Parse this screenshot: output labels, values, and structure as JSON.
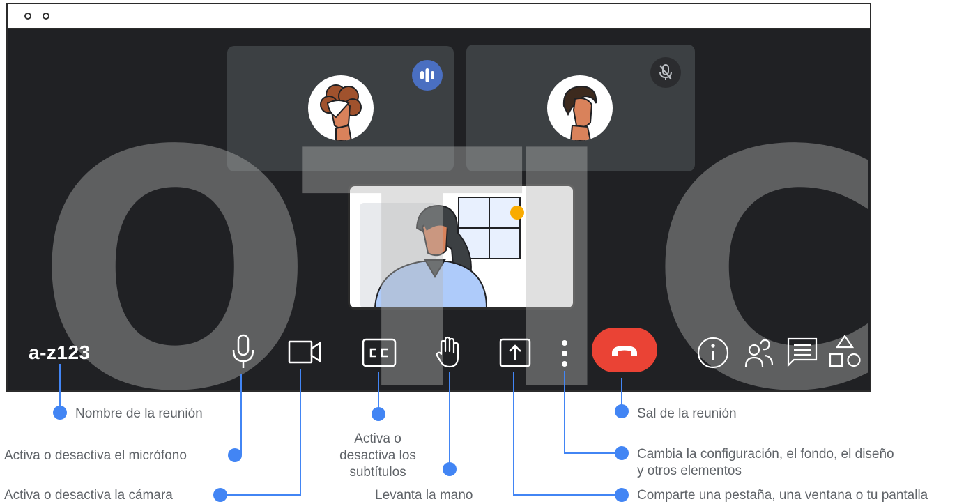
{
  "meeting": {
    "code": "a-z123"
  },
  "watermark": {
    "text": [
      "O",
      "T",
      "I",
      "C"
    ]
  },
  "colors": {
    "accent_blue": "#4285f4",
    "end_call_red": "#ea4335",
    "window_bg": "#202124",
    "tile_bg": "#3c4043",
    "speaking_badge": "#4a6fc1"
  },
  "toolbar": {
    "icons": [
      "mic-icon",
      "camera-icon",
      "captions-icon",
      "raise-hand-icon",
      "present-icon",
      "more-options-icon",
      "end-call-icon",
      "info-icon",
      "people-icon",
      "chat-icon",
      "activities-icon"
    ]
  },
  "callouts": {
    "meeting_name": "Nombre de la reunión",
    "mic": "Activa o desactiva el micrófono",
    "camera": "Activa o desactiva la cámara",
    "captions": [
      "Activa o",
      "desactiva los",
      "subtítulos"
    ],
    "raise_hand": "Levanta la mano",
    "leave": "Sal de la reunión",
    "settings": [
      "Cambia la configuración, el fondo, el diseño",
      "y otros elementos"
    ],
    "present": "Comparte una pestaña, una ventana o tu pantalla"
  }
}
